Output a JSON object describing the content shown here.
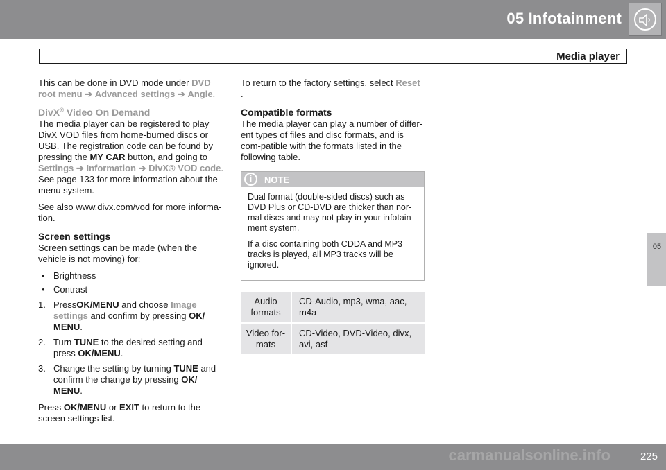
{
  "header": {
    "chapter_title": "05  Infotainment",
    "icon": "speaker-icon",
    "section_title": "Media player"
  },
  "side_tab": {
    "label": "05"
  },
  "footer": {
    "page_number": "225",
    "watermark": "carmanualsonline.info"
  },
  "left": {
    "intro": {
      "text1": "This can be done in DVD mode under ",
      "path1": "DVD root menu",
      "arrow": "➔",
      "path2": "Advanced settings",
      "path3": "Angle",
      "end": "."
    },
    "divx": {
      "heading_pre": "DivX",
      "heading_sup": "®",
      "heading_post": " Video On Demand",
      "text1": "The media player can be registered to play DivX VOD files from home-burned discs or USB. The registration code can be found by pressing the ",
      "key_mycar": "MY CAR",
      "text2": " button, and going to ",
      "path1": "Settings",
      "path2": "Information",
      "path3": "DivX® VOD code",
      "text3": ". See page 133 for more information about the menu system.",
      "see_also": "See also www.divx.com/vod for more informa-tion."
    },
    "screen": {
      "heading": "Screen settings",
      "intro": "Screen settings can be made (when the vehicle is not moving) for:",
      "bullets": [
        "Brightness",
        "Contrast"
      ],
      "step1_num": "1.",
      "step1_a": "Press",
      "step1_key": "OK/MENU",
      "step1_b": " and choose ",
      "step1_path": "Image settings",
      "step1_c": " and confirm by pressing ",
      "step1_key2": "OK/ MENU",
      "step1_d": ".",
      "step2_num": "2.",
      "step2_a": "Turn ",
      "step2_key": "TUNE",
      "step2_b": " to the desired setting and press ",
      "step2_key2": "OK/MENU",
      "step2_c": ".",
      "step3_num": "3.",
      "step3_a": "Change the setting by turning ",
      "step3_key": "TUNE",
      "step3_b": " and confirm the change by pressing ",
      "step3_key2": "OK/ MENU",
      "step3_c": ".",
      "outro_a": "Press ",
      "outro_key1": "OK/MENU",
      "outro_b": " or ",
      "outro_key2": "EXIT",
      "outro_c": " to return to the screen settings list."
    }
  },
  "right": {
    "reset_text": "To return to the factory settings, select ",
    "reset_path": "Reset",
    "reset_end": " .",
    "compat_heading": "Compatible formats",
    "compat_text": "The media player can play a number of differ-ent types of files and disc formats, and is com-patible with the formats listed in the following table.",
    "note": {
      "icon": "info-icon",
      "icon_glyph": "i",
      "label": "NOTE",
      "p1": "Dual format (double-sided discs) such as DVD Plus or CD-DVD are thicker than nor-mal discs and may not play in your infotain-ment system.",
      "p2": "If a disc containing both CDDA and MP3 tracks is played, all MP3 tracks will be ignored."
    },
    "formats": [
      {
        "name": "Audio formats",
        "value": "CD-Audio, mp3, wma, aac, m4a"
      },
      {
        "name": "Video for-mats",
        "value": "CD-Video, DVD-Video, divx, avi, asf"
      }
    ]
  }
}
